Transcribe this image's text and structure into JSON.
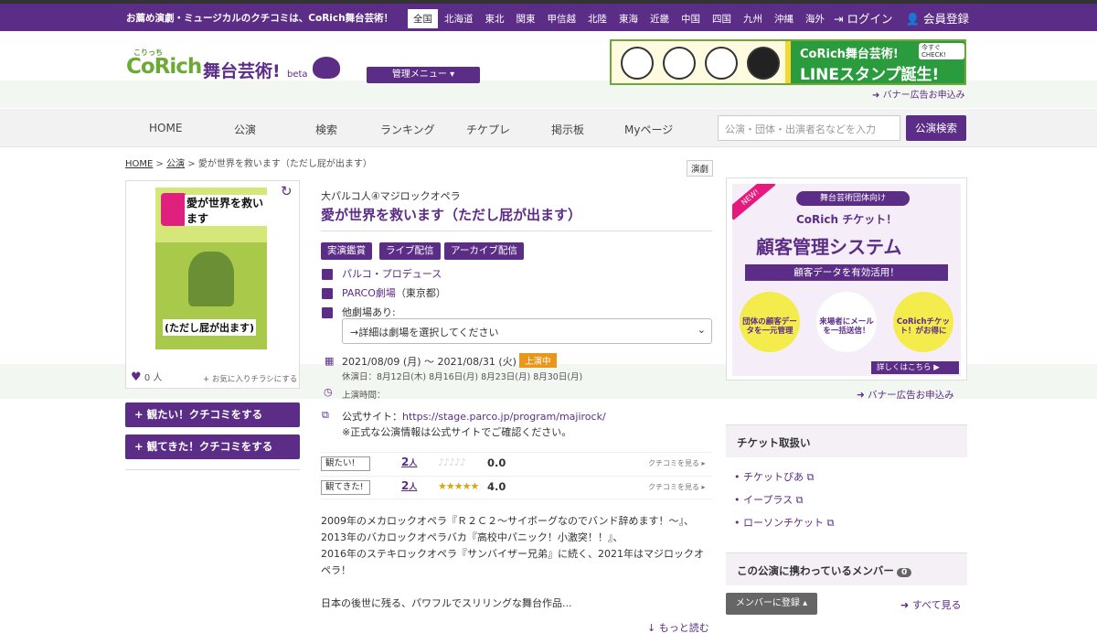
{
  "topbar": {
    "message": "お薦め演劇・ミュージカルのクチコミは、CoRich舞台芸術！",
    "regions": [
      "全国",
      "北海道",
      "東北",
      "関東",
      "甲信越",
      "北陸",
      "東海",
      "近畿",
      "中国",
      "四国",
      "九州",
      "沖縄",
      "海外"
    ],
    "active_region": "全国",
    "login": "ログイン",
    "register": "会員登録"
  },
  "header": {
    "logo_small": "こりっち",
    "logo_corich": "CoRich",
    "logo_butai": "舞台芸術!",
    "logo_beta": "beta",
    "admin_menu": "管理メニュー ▾",
    "banner_line1": "CoRich舞台芸術!",
    "banner_line2": "LINEスタンプ誕生!",
    "banner_check": "今すぐCHECK!",
    "banner_link": "バナー広告お申込み"
  },
  "nav": {
    "items": [
      "HOME",
      "公演",
      "検索",
      "ランキング",
      "チケプレ",
      "掲示板",
      "Myページ"
    ],
    "search_placeholder": "公演・団体・出演者名などを入力",
    "search_button": "公演検索"
  },
  "breadcrumb": {
    "home": "HOME",
    "sep": ">",
    "kouen": "公演",
    "current": "愛が世界を救います（ただし屁が出ます）"
  },
  "genre": "演劇",
  "flyer": {
    "text1": "愛が世界を救います",
    "text2": "(ただし屁が出ます)"
  },
  "likes": {
    "count": "0",
    "unit": "人",
    "fav": "お気に入りチラシにする"
  },
  "buttons": {
    "mitai": "観たい！クチコミをする",
    "mitekita": "観てきた！クチコミをする"
  },
  "show": {
    "subtitle": "大パルコ人④マジロックオペラ",
    "title": "愛が世界を救います（ただし屁が出ます）",
    "tags": [
      "実演鑑賞",
      "ライブ配信",
      "アーカイブ配信"
    ],
    "producer": "パルコ・プロデュース",
    "venue": "PARCO劇場",
    "venue_area": "（東京都）",
    "other_venues": "他劇場あり:",
    "venue_select": "→詳細は劇場を選択してください",
    "dates": "2021/08/09 (月) 〜 2021/08/31 (火)",
    "status": "上演中",
    "holidays": "休演日：8月12日(木) 8月16日(月) 8月23日(月) 8月30日(月)",
    "runtime": "上演時間：",
    "site_label": "公式サイト：",
    "site_url": "https://stage.parco.jp/program/majirock/",
    "site_note": "※正式な公演情報は公式サイトでご確認ください。"
  },
  "ratings": [
    {
      "label": "観たい!",
      "count": "2",
      "unit": "人",
      "stars": "♪♪♪♪♪",
      "score": "0.0",
      "see": "クチコミを見る"
    },
    {
      "label": "観てきた!",
      "count": "2",
      "unit": "人",
      "stars": "★★★★★",
      "score": "4.0",
      "see": "クチコミを見る"
    }
  ],
  "description": "2009年のメカロックオペラ『Ｒ２Ｃ２〜サイボーグなのでバンド辞めます！〜』、\n2013年のバカロックオペラバカ『高校中パニック！小激突！！』、\n2016年のステキロックオペラ『サンバイザー兄弟』に続く、2021年はマジロックオペラ！\n\n日本の後世に残る、パワフルでスリリングな舞台作品...",
  "more": "もっと読む",
  "ad": {
    "new": "NEW!",
    "top": "舞台芸術団体向け",
    "line2": "CoRich チケット！",
    "line3": "顧客管理システム",
    "line4": "顧客データを有効活用！",
    "c1": "団体の顧客データを一元管理",
    "c2": "来場者にメールを一括送信！",
    "c3": "CoRichチケット！がお得に",
    "foot": "詳しくはこちら ▶",
    "link": "バナー広告お申込み"
  },
  "tickets": {
    "heading": "チケット取扱い",
    "items": [
      "チケットぴあ",
      "イープラス",
      "ローソンチケット"
    ]
  },
  "members": {
    "heading": "この公演に携わっているメンバー",
    "count": "0",
    "register": "メンバーに登録 ▴",
    "see_all": "すべて見る"
  }
}
